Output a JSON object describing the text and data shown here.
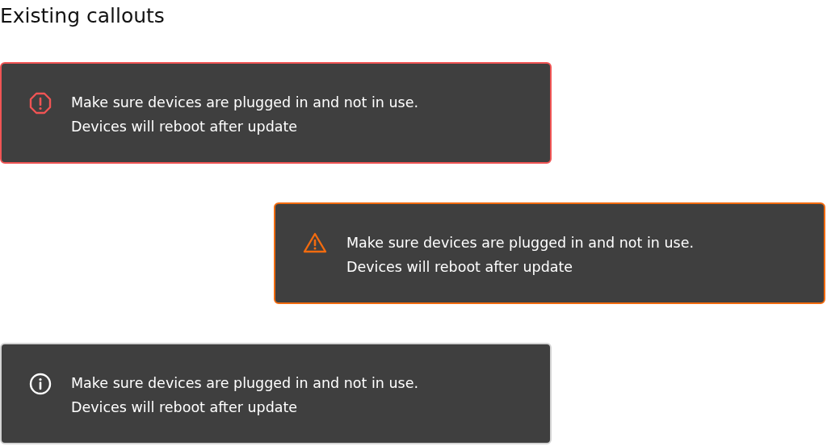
{
  "heading": "Existing callouts",
  "callouts": [
    {
      "kind": "error",
      "shifted_right": false,
      "lines": [
        "Make sure devices are plugged in and not in use.",
        "Devices will reboot after update"
      ]
    },
    {
      "kind": "warning",
      "shifted_right": true,
      "lines": [
        "Make sure devices are plugged in and not in use.",
        "Devices will reboot after update"
      ]
    },
    {
      "kind": "info",
      "shifted_right": false,
      "lines": [
        "Make sure devices are plugged in and not in use.",
        "Devices will reboot after update"
      ]
    }
  ]
}
